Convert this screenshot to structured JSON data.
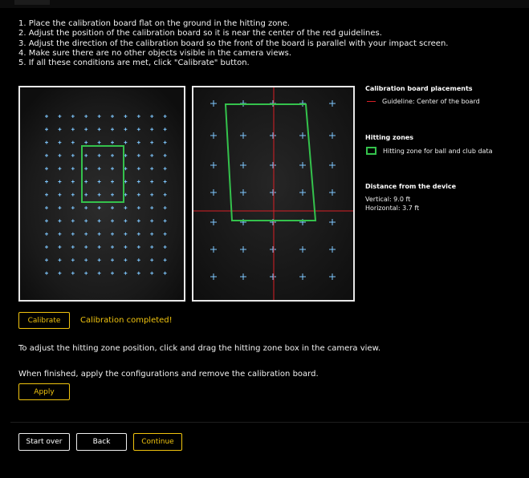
{
  "instructions": [
    "1. Place the calibration board flat on the ground in the hitting zone.",
    "2. Adjust the position of the calibration board so it is near the center of the red guidelines.",
    "3. Adjust the direction of the calibration board so the front of the board is parallel with your impact screen.",
    "4. Make sure there are no other objects visible in the camera views.",
    "5. If all these conditions are met, click \"Calibrate\" button."
  ],
  "legend": {
    "placements_heading": "Calibration board placements",
    "guideline_label": "Guideline: Center of the board",
    "hitting_heading": "Hitting zones",
    "hitting_label": "Hitting zone for ball and club data",
    "distance_heading": "Distance from the device",
    "vertical": "Vertical: 9.0 ft",
    "horizontal": "Horizontal: 3.7 ft"
  },
  "calibrate_label": "Calibrate",
  "calibration_status": "Calibration completed!",
  "adjust_text": "To adjust the hitting zone position, click and drag the hitting zone box in the camera view.",
  "finish_text": "When finished, apply the configurations and remove the calibration board.",
  "apply_label": "Apply",
  "footer": {
    "start_over": "Start over",
    "back": "Back",
    "continue": "Continue"
  },
  "colors": {
    "accent": "#f1c40f",
    "guideline": "#d81f26",
    "hitting_zone": "#34c24c",
    "marker": "#7fc8ff"
  }
}
